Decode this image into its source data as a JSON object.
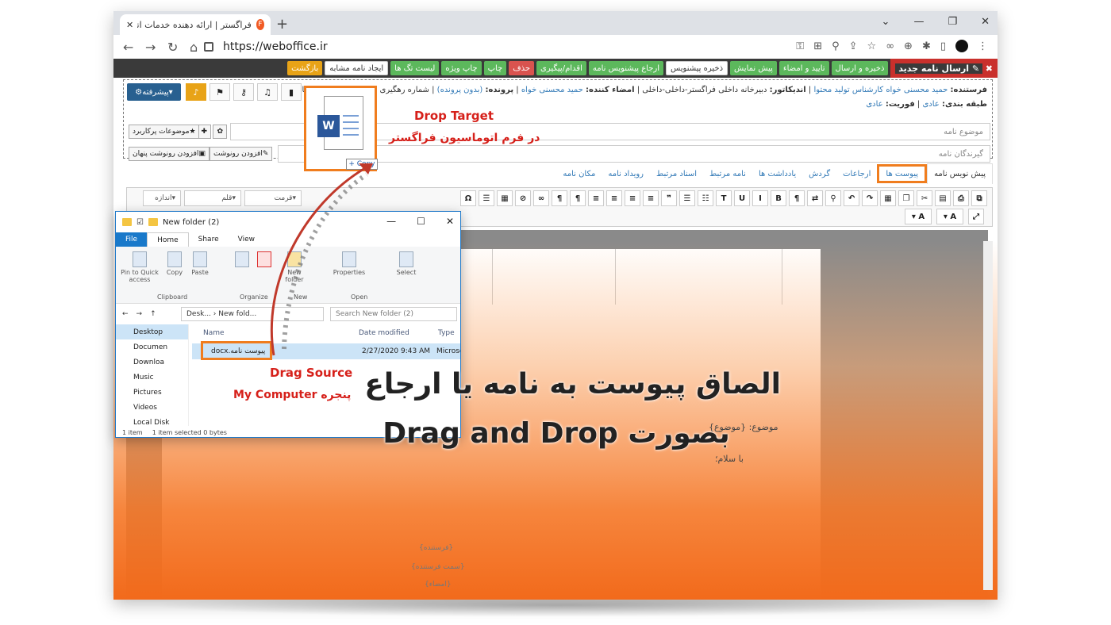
{
  "browser": {
    "tab_title": "فراگستر | ارائه دهنده خدمات اتوماسیون اد",
    "url": "https://weboffice.ir"
  },
  "app_toolbar": {
    "title": "ارسال نامه جدید",
    "buttons": [
      "ذخیره و ارسال",
      "تایید و امضاء",
      "پیش نمایش",
      "ذخیره پیشنویس",
      "ارجاع پیشنویس نامه",
      "اقدام/پیگیری",
      "حذف",
      "چاپ",
      "چاپ ویژه",
      "لیست تگ ها",
      "ایجاد نامه مشابه",
      "بازگشت"
    ]
  },
  "form": {
    "meta_line1_label_sender": "فرستنده:",
    "meta_line1_sender": "حمید محسنی خواه کارشناس تولید محتوا",
    "meta_indicator_label": "اندیکاتور:",
    "meta_indicator": "دبیرخانه داخلی فراگستر-داخلی-داخلی",
    "meta_signer_label": "امضاء کننده:",
    "meta_signer": "حمید محسنی خواه",
    "meta_folder_label": "پرونده:",
    "meta_folder": "(بدون پرونده)",
    "meta_tracking": "شماره رهگیری نامه: ۱۸۲۲۲۸ | قالب نامه:",
    "meta_line2_class_label": "طبقه بندی:",
    "meta_line2_class": "عادی",
    "meta_line2_priority_label": "فوریت:",
    "meta_line2_priority": "عادی",
    "subject_placeholder": "موضوع نامه",
    "receivers_placeholder": "گیرندگان نامه",
    "btn_subjects": "موضوعات پرکاربرد",
    "btn_add_cc": "افزودن رونوشت",
    "btn_add_hidden_cc": "افزودن رونوشت پنهان",
    "btn_advanced": "پیشرفته"
  },
  "tabs": [
    {
      "label": "پیش نویس نامه",
      "active": true
    },
    {
      "label": "پیوست ها",
      "highlight": true
    },
    {
      "label": "ارجاعات"
    },
    {
      "label": "گردش"
    },
    {
      "label": "یادداشت ها"
    },
    {
      "label": "نامه مرتبط"
    },
    {
      "label": "اسناد مرتبط"
    },
    {
      "label": "رویداد نامه"
    },
    {
      "label": "مکان نامه"
    }
  ],
  "editor": {
    "sel_size": "اندازه",
    "sel_font": "قلم",
    "sel_format": "قرمت",
    "paper_subject": "موضوع: {موضوع}",
    "paper_greeting": "با سلام؛",
    "paper_sender": "{فرستنده}",
    "paper_sender_pos": "{سمت فرستنده}",
    "paper_sign": "{امضاء}"
  },
  "explorer": {
    "title": "New folder (2)",
    "tabs": [
      "File",
      "Home",
      "Share",
      "View"
    ],
    "ribbon_buttons": [
      "Pin to Quick access",
      "Copy",
      "Paste",
      "New folder",
      "Properties",
      "Select"
    ],
    "groups": [
      "Clipboard",
      "Organize",
      "New",
      "Open"
    ],
    "path": "Desk... › New fold...",
    "search_placeholder": "Search New folder (2)",
    "nav": [
      "Desktop",
      "Documen",
      "Downloa",
      "Music",
      "Pictures",
      "Videos",
      "Local Disk"
    ],
    "col_name": "Name",
    "col_date": "Date modified",
    "col_type": "Type",
    "file_name": "پیوست نامه.docx",
    "file_date": "2/27/2020 9:43 AM",
    "file_type": "Microsc",
    "status_items": "1 item",
    "status_selected": "1 item selected  0 bytes"
  },
  "annotations": {
    "drop_target": "Drop Target",
    "drop_target_sub": "در فرم اتوماسیون فراگستر",
    "drag_source": "Drag Source",
    "drag_source_sub": "پنجره My Computer",
    "copy_tag": "+ Copy",
    "headline1": "الصاق پیوست به نامه یا ارجاع",
    "headline2": "بصورت Drag and Drop"
  },
  "colors": {
    "accent": "#f07d1e",
    "label_red": "#d6201a"
  }
}
